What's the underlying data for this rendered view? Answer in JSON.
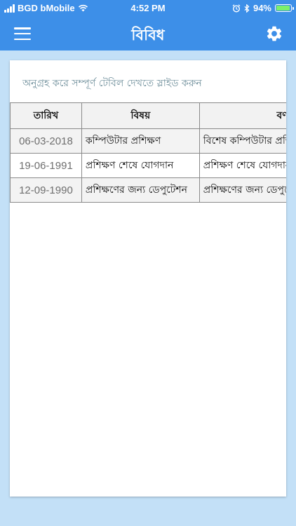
{
  "status": {
    "carrier": "BGD bMobile",
    "time": "4:52 PM",
    "battery_percent": "94%",
    "battery_level": 0.94,
    "battery_color": "#7cf06a"
  },
  "appbar": {
    "title": "বিবিধ",
    "background": "#3d8fe8"
  },
  "card": {
    "hint": "অনুগ্রহ করে সম্পূর্ণ টেবিল দেখতে স্লাইড করুন"
  },
  "table": {
    "headers": [
      "তারিখ",
      "বিষয়",
      "বর্ণনা"
    ],
    "rows": [
      {
        "date": "06-03-2018",
        "subject": "কম্পিউটার প্রশিক্ষণ",
        "description": "বিশেষ কম্পিউটার প্রশিক্ষণ"
      },
      {
        "date": "19-06-1991",
        "subject": "প্রশিক্ষণ শেষে যোগদান",
        "description": "প্রশিক্ষণ শেষে যোগদান"
      },
      {
        "date": "12-09-1990",
        "subject": "প্রশিক্ষণের জন্য ডেপুটেশন",
        "description": "প্রশিক্ষণের জন্য ডেপুটেশন"
      }
    ]
  },
  "icons": {
    "menu": "hamburger-menu-icon",
    "settings": "gear-icon",
    "wifi": "wifi-icon",
    "alarm": "alarm-icon",
    "bluetooth": "bluetooth-icon",
    "battery": "battery-icon"
  }
}
